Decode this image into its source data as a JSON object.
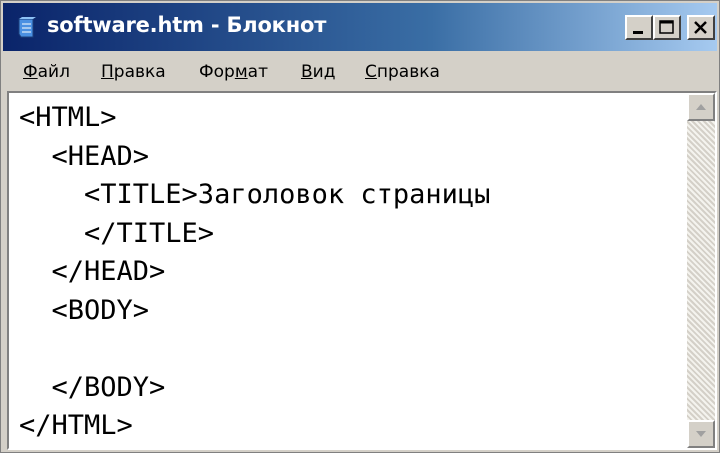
{
  "window": {
    "title": "software.htm - Блокнот",
    "icon": "notepad-icon",
    "controls": [
      "minimize-icon",
      "maximize-icon",
      "close-icon"
    ]
  },
  "menu": [
    {
      "accel": "Ф",
      "rest": "айл"
    },
    {
      "accel": "П",
      "rest": "равка"
    },
    {
      "pre": "Фор",
      "accel": "м",
      "rest": "ат"
    },
    {
      "accel": "В",
      "rest": "ид"
    },
    {
      "accel": "С",
      "rest": "правка"
    }
  ],
  "document": {
    "lines": [
      "<HTML>",
      "  <HEAD>",
      "    <TITLE>Заголовок страницы",
      "    </TITLE>",
      "  </HEAD>",
      "  <BODY>",
      "",
      "  </BODY>",
      "</HTML>"
    ]
  },
  "scrollbar": {
    "up_icon": "scroll-up-arrow-icon",
    "down_icon": "scroll-down-arrow-icon"
  }
}
